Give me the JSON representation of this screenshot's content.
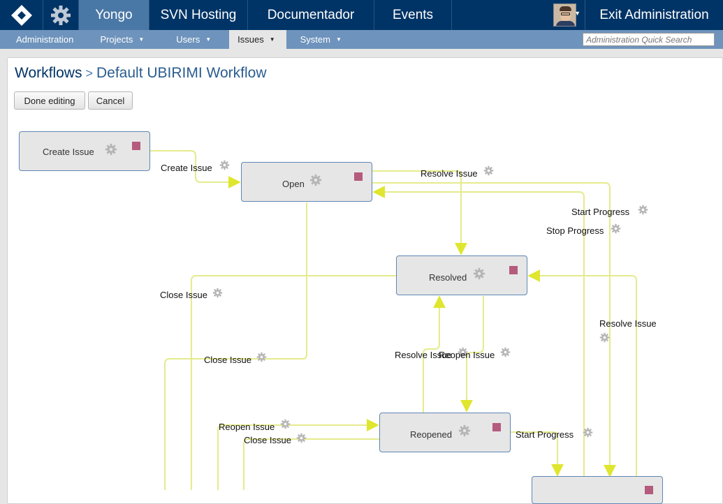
{
  "topnav": {
    "items": [
      {
        "label": "Yongo",
        "active": true
      },
      {
        "label": "SVN Hosting",
        "active": false
      },
      {
        "label": "Documentador",
        "active": false
      },
      {
        "label": "Events",
        "active": false
      }
    ],
    "exit_label": "Exit Administration"
  },
  "subnav": {
    "items": [
      {
        "label": "Administration",
        "active": false
      },
      {
        "label": "Projects",
        "active": false
      },
      {
        "label": "Users",
        "active": false
      },
      {
        "label": "Issues",
        "active": true
      },
      {
        "label": "System",
        "active": false
      }
    ],
    "search_placeholder": "Administration Quick Search"
  },
  "breadcrumb": {
    "root": "Workflows",
    "separator": ">",
    "current": "Default UBIRIMI Workflow"
  },
  "buttons": {
    "done": "Done editing",
    "cancel": "Cancel"
  },
  "workflow": {
    "nodes": [
      {
        "label": "Create Issue"
      },
      {
        "label": "Open"
      },
      {
        "label": "Resolved"
      },
      {
        "label": "Reopened"
      }
    ],
    "transitions": [
      {
        "label": "Create Issue"
      },
      {
        "label": "Resolve Issue"
      },
      {
        "label": "Start Progress"
      },
      {
        "label": "Stop Progress"
      },
      {
        "label": "Close Issue"
      },
      {
        "label": "Resolve Issue"
      },
      {
        "label": "Close Issue"
      },
      {
        "label": "Resolve Issue"
      },
      {
        "label": "Reopen Issue"
      },
      {
        "label": "Reopen Issue"
      },
      {
        "label": "Close Issue"
      },
      {
        "label": "Start Progress"
      }
    ]
  },
  "colors": {
    "topbar": "#003466",
    "topbar_active": "#4a78a6",
    "subbar": "#6e93bc",
    "transition_line": "#e1e85a",
    "node_border": "#5e86b4",
    "node_marker": "#b45b7e"
  }
}
